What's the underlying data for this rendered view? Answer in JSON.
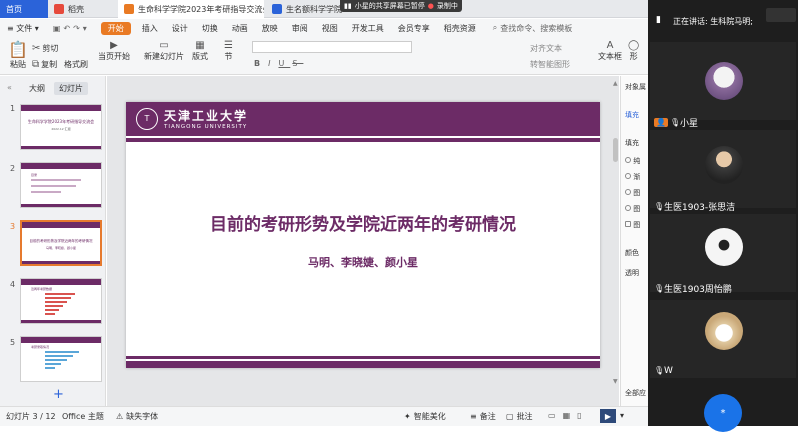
{
  "tabs": [
    {
      "label": "首页"
    },
    {
      "label": "稻壳"
    },
    {
      "label": "生命科学学院2023年考研指导交流会"
    },
    {
      "label": "生名额科学学院"
    }
  ],
  "share_banner": {
    "text": "小星的共享屏幕已暂停",
    "rec": "录制中"
  },
  "menu": {
    "file": "文件",
    "items": [
      "开始",
      "插入",
      "设计",
      "切换",
      "动画",
      "放映",
      "审阅",
      "视图",
      "开发工具",
      "会员专享",
      "稻壳资源"
    ],
    "search": "查找命令、搜索模板"
  },
  "ribbon": {
    "cut": "剪切",
    "copy": "复制",
    "format_painter": "格式刷",
    "paste": "粘贴",
    "from_current": "当页开始",
    "new_slide": "新建幻灯片",
    "layout": "版式",
    "section": "节",
    "align": "对齐文本",
    "to_smartart": "转智能图形",
    "textbox": "文本框",
    "shape": "形"
  },
  "leftpanel": {
    "tab_outline": "大纲",
    "tab_slides": "幻灯片",
    "add": "+",
    "thumbs": [
      {
        "num": "1",
        "title": "生命科学学院2023年考研指导交流会",
        "sub": "2022.12 汇报"
      },
      {
        "num": "2",
        "title": "目录"
      },
      {
        "num": "3",
        "title": "目前的考研形势及学院近两年的考研情况",
        "sub": "马明、李晓婕、颜小星"
      },
      {
        "num": "4",
        "title": "近两年考研数据"
      },
      {
        "num": "5",
        "title": "考研录取情况"
      }
    ]
  },
  "slide": {
    "uni_cn": "天津工业大学",
    "uni_en": "TIANGONG UNIVERSITY",
    "seal": "T",
    "title": "目前的考研形势及学院近两年的考研情况",
    "authors": "马明、李晓婕、颜小星"
  },
  "rightpane": {
    "header": "对象属",
    "fill_tab": "填充",
    "fill_label": "填充",
    "opt1": "纯",
    "opt2": "渐",
    "opt3": "图",
    "opt4": "图",
    "opt5": "图",
    "color": "颜色",
    "transparency": "透明",
    "apply_all": "全部应"
  },
  "status": {
    "slide_pos": "幻灯片 3 / 12",
    "theme": "Office 主题",
    "missing_font": "缺失字体",
    "beautify": "智能美化",
    "notes": "备注",
    "comment": "批注"
  },
  "meeting": {
    "speaking": "正在讲话: 生科院马明;",
    "participants": [
      {
        "name": "小星",
        "badge": true
      },
      {
        "name": "生医1903-张思洁"
      },
      {
        "name": "生医1903周怡鹏"
      },
      {
        "name": "W"
      }
    ],
    "bubble": "*"
  },
  "colors": {
    "accent": "#6c2b66",
    "wps_orange": "#e97a24",
    "home_blue": "#2b63d9"
  }
}
